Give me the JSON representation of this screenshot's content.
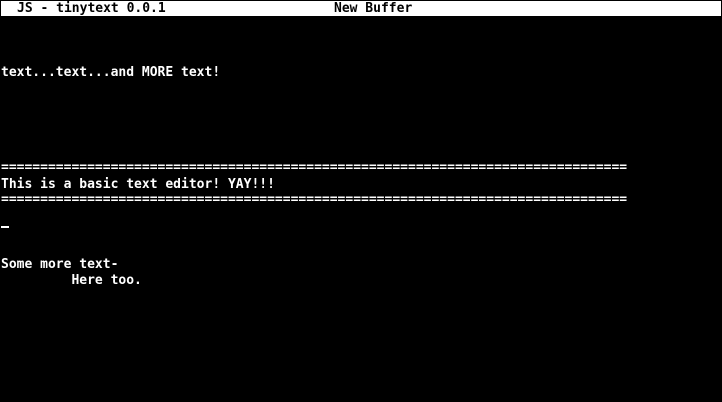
{
  "window": {
    "app_title": "JS - tinytext 0.0.1",
    "buffer_name": "New Buffer"
  },
  "buffer": {
    "line_1": "text...text...and MORE text!",
    "rule_top": "================================================================================",
    "banner": "This is a basic text editor! YAY!!!",
    "rule_bottom": "================================================================================",
    "line_2": "Some more text-",
    "line_3": "         Here too."
  }
}
